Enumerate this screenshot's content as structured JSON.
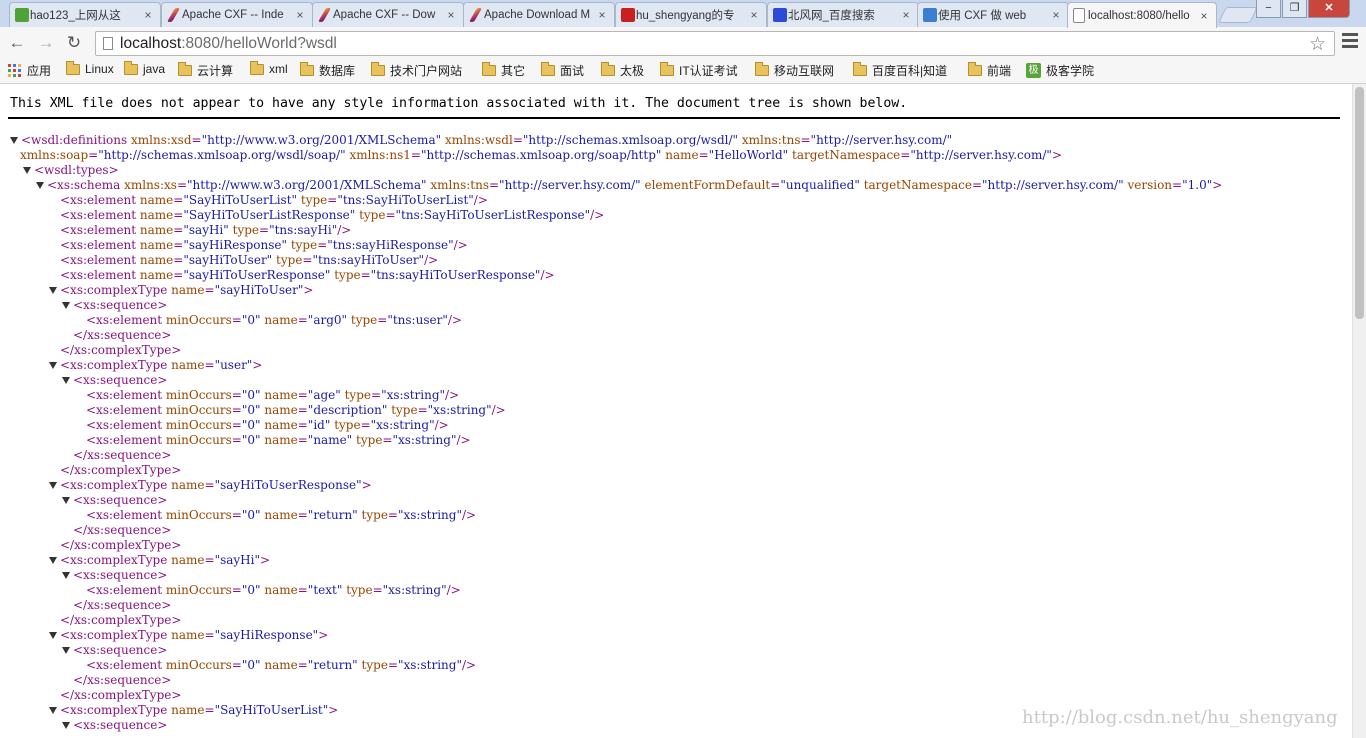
{
  "tabs": [
    {
      "title": "hao123_上网从这",
      "icon": "hao123-icon",
      "color": "#4da338"
    },
    {
      "title": "Apache CXF -- Inde",
      "icon": "apache-feather-icon",
      "color": "#b0305f"
    },
    {
      "title": "Apache CXF -- Dow",
      "icon": "apache-feather-icon",
      "color": "#b0305f"
    },
    {
      "title": "Apache Download M",
      "icon": "apache-feather-icon",
      "color": "#b0305f"
    },
    {
      "title": "hu_shengyang的专",
      "icon": "csdn-icon",
      "color": "#c9201f"
    },
    {
      "title": "北风网_百度搜索",
      "icon": "baidu-paw-icon",
      "color": "#2b4bd8"
    },
    {
      "title": "使用 CXF 做 web",
      "icon": "ibm-globe-icon",
      "color": "#3b7fd1"
    },
    {
      "title": "localhost:8080/hello",
      "icon": "page-icon",
      "color": "#ffffff"
    }
  ],
  "window": {
    "minimize": "−",
    "maximize": "❐",
    "close": "✕"
  },
  "toolbar": {
    "back": "←",
    "forward": "→",
    "reload": "↻"
  },
  "address": {
    "host": "localhost",
    "rest": ":8080/helloWorld?wsdl"
  },
  "bookmarks": {
    "apps": "应用",
    "folders": [
      "Linux",
      "java",
      "云计算",
      "xml",
      "数据库",
      "技术门户网站",
      "其它",
      "面试",
      "太极",
      "IT认证考试",
      "移动互联网",
      "百度百科|知道",
      "前端"
    ],
    "jike": "极客学院",
    "jike_icon_text": "极"
  },
  "xml_notice": "This XML file does not appear to have any style information associated with it. The document tree is shown below.",
  "watermark": "http://blog.csdn.net/hu_shengyang",
  "xml_lines": [
    {
      "indent": 0,
      "tri": true,
      "parts": [
        [
          "t",
          "<wsdl:definitions "
        ],
        [
          "n",
          "xmlns:xsd"
        ],
        [
          "t",
          "="
        ],
        [
          "v",
          "\"http://www.w3.org/2001/XMLSchema\""
        ],
        [
          "t",
          " "
        ],
        [
          "n",
          "xmlns:wsdl"
        ],
        [
          "t",
          "="
        ],
        [
          "v",
          "\"http://schemas.xmlsoap.org/wsdl/\""
        ],
        [
          "t",
          " "
        ],
        [
          "n",
          "xmlns:tns"
        ],
        [
          "t",
          "="
        ],
        [
          "v",
          "\"http://server.hsy.com/\""
        ]
      ]
    },
    {
      "indent": 0,
      "tri": false,
      "wrap": true,
      "parts": [
        [
          "n",
          "xmlns:soap"
        ],
        [
          "t",
          "="
        ],
        [
          "v",
          "\"http://schemas.xmlsoap.org/wsdl/soap/\""
        ],
        [
          "t",
          " "
        ],
        [
          "n",
          "xmlns:ns1"
        ],
        [
          "t",
          "="
        ],
        [
          "v",
          "\"http://schemas.xmlsoap.org/soap/http\""
        ],
        [
          "t",
          " "
        ],
        [
          "n",
          "name"
        ],
        [
          "t",
          "="
        ],
        [
          "v",
          "\"HelloWorld\""
        ],
        [
          "t",
          " "
        ],
        [
          "n",
          "targetNamespace"
        ],
        [
          "t",
          "="
        ],
        [
          "v",
          "\"http://server.hsy.com/\""
        ],
        [
          "t",
          ">"
        ]
      ]
    },
    {
      "indent": 1,
      "tri": true,
      "parts": [
        [
          "t",
          "<wsdl:types>"
        ]
      ]
    },
    {
      "indent": 2,
      "tri": true,
      "parts": [
        [
          "t",
          "<xs:schema "
        ],
        [
          "n",
          "xmlns:xs"
        ],
        [
          "t",
          "="
        ],
        [
          "v",
          "\"http://www.w3.org/2001/XMLSchema\""
        ],
        [
          "t",
          " "
        ],
        [
          "n",
          "xmlns:tns"
        ],
        [
          "t",
          "="
        ],
        [
          "v",
          "\"http://server.hsy.com/\""
        ],
        [
          "t",
          " "
        ],
        [
          "n",
          "elementFormDefault"
        ],
        [
          "t",
          "="
        ],
        [
          "v",
          "\"unqualified\""
        ],
        [
          "t",
          " "
        ],
        [
          "n",
          "targetNamespace"
        ],
        [
          "t",
          "="
        ],
        [
          "v",
          "\"http://server.hsy.com/\""
        ],
        [
          "t",
          " "
        ],
        [
          "n",
          "version"
        ],
        [
          "t",
          "="
        ],
        [
          "v",
          "\"1.0\""
        ],
        [
          "t",
          ">"
        ]
      ]
    },
    {
      "indent": 3,
      "tri": false,
      "parts": [
        [
          "t",
          "<xs:element "
        ],
        [
          "n",
          "name"
        ],
        [
          "t",
          "="
        ],
        [
          "v",
          "\"SayHiToUserList\""
        ],
        [
          "t",
          " "
        ],
        [
          "n",
          "type"
        ],
        [
          "t",
          "="
        ],
        [
          "v",
          "\"tns:SayHiToUserList\""
        ],
        [
          "t",
          "/>"
        ]
      ]
    },
    {
      "indent": 3,
      "tri": false,
      "parts": [
        [
          "t",
          "<xs:element "
        ],
        [
          "n",
          "name"
        ],
        [
          "t",
          "="
        ],
        [
          "v",
          "\"SayHiToUserListResponse\""
        ],
        [
          "t",
          " "
        ],
        [
          "n",
          "type"
        ],
        [
          "t",
          "="
        ],
        [
          "v",
          "\"tns:SayHiToUserListResponse\""
        ],
        [
          "t",
          "/>"
        ]
      ]
    },
    {
      "indent": 3,
      "tri": false,
      "parts": [
        [
          "t",
          "<xs:element "
        ],
        [
          "n",
          "name"
        ],
        [
          "t",
          "="
        ],
        [
          "v",
          "\"sayHi\""
        ],
        [
          "t",
          " "
        ],
        [
          "n",
          "type"
        ],
        [
          "t",
          "="
        ],
        [
          "v",
          "\"tns:sayHi\""
        ],
        [
          "t",
          "/>"
        ]
      ]
    },
    {
      "indent": 3,
      "tri": false,
      "parts": [
        [
          "t",
          "<xs:element "
        ],
        [
          "n",
          "name"
        ],
        [
          "t",
          "="
        ],
        [
          "v",
          "\"sayHiResponse\""
        ],
        [
          "t",
          " "
        ],
        [
          "n",
          "type"
        ],
        [
          "t",
          "="
        ],
        [
          "v",
          "\"tns:sayHiResponse\""
        ],
        [
          "t",
          "/>"
        ]
      ]
    },
    {
      "indent": 3,
      "tri": false,
      "parts": [
        [
          "t",
          "<xs:element "
        ],
        [
          "n",
          "name"
        ],
        [
          "t",
          "="
        ],
        [
          "v",
          "\"sayHiToUser\""
        ],
        [
          "t",
          " "
        ],
        [
          "n",
          "type"
        ],
        [
          "t",
          "="
        ],
        [
          "v",
          "\"tns:sayHiToUser\""
        ],
        [
          "t",
          "/>"
        ]
      ]
    },
    {
      "indent": 3,
      "tri": false,
      "parts": [
        [
          "t",
          "<xs:element "
        ],
        [
          "n",
          "name"
        ],
        [
          "t",
          "="
        ],
        [
          "v",
          "\"sayHiToUserResponse\""
        ],
        [
          "t",
          " "
        ],
        [
          "n",
          "type"
        ],
        [
          "t",
          "="
        ],
        [
          "v",
          "\"tns:sayHiToUserResponse\""
        ],
        [
          "t",
          "/>"
        ]
      ]
    },
    {
      "indent": 3,
      "tri": true,
      "parts": [
        [
          "t",
          "<xs:complexType "
        ],
        [
          "n",
          "name"
        ],
        [
          "t",
          "="
        ],
        [
          "v",
          "\"sayHiToUser\""
        ],
        [
          "t",
          ">"
        ]
      ]
    },
    {
      "indent": 4,
      "tri": true,
      "parts": [
        [
          "t",
          "<xs:sequence>"
        ]
      ]
    },
    {
      "indent": 5,
      "tri": false,
      "parts": [
        [
          "t",
          "<xs:element "
        ],
        [
          "n",
          "minOccurs"
        ],
        [
          "t",
          "="
        ],
        [
          "v",
          "\"0\""
        ],
        [
          "t",
          " "
        ],
        [
          "n",
          "name"
        ],
        [
          "t",
          "="
        ],
        [
          "v",
          "\"arg0\""
        ],
        [
          "t",
          " "
        ],
        [
          "n",
          "type"
        ],
        [
          "t",
          "="
        ],
        [
          "v",
          "\"tns:user\""
        ],
        [
          "t",
          "/>"
        ]
      ]
    },
    {
      "indent": 4,
      "tri": false,
      "parts": [
        [
          "t",
          "</xs:sequence>"
        ]
      ]
    },
    {
      "indent": 3,
      "tri": false,
      "parts": [
        [
          "t",
          "</xs:complexType>"
        ]
      ]
    },
    {
      "indent": 3,
      "tri": true,
      "parts": [
        [
          "t",
          "<xs:complexType "
        ],
        [
          "n",
          "name"
        ],
        [
          "t",
          "="
        ],
        [
          "v",
          "\"user\""
        ],
        [
          "t",
          ">"
        ]
      ]
    },
    {
      "indent": 4,
      "tri": true,
      "parts": [
        [
          "t",
          "<xs:sequence>"
        ]
      ]
    },
    {
      "indent": 5,
      "tri": false,
      "parts": [
        [
          "t",
          "<xs:element "
        ],
        [
          "n",
          "minOccurs"
        ],
        [
          "t",
          "="
        ],
        [
          "v",
          "\"0\""
        ],
        [
          "t",
          " "
        ],
        [
          "n",
          "name"
        ],
        [
          "t",
          "="
        ],
        [
          "v",
          "\"age\""
        ],
        [
          "t",
          " "
        ],
        [
          "n",
          "type"
        ],
        [
          "t",
          "="
        ],
        [
          "v",
          "\"xs:string\""
        ],
        [
          "t",
          "/>"
        ]
      ]
    },
    {
      "indent": 5,
      "tri": false,
      "parts": [
        [
          "t",
          "<xs:element "
        ],
        [
          "n",
          "minOccurs"
        ],
        [
          "t",
          "="
        ],
        [
          "v",
          "\"0\""
        ],
        [
          "t",
          " "
        ],
        [
          "n",
          "name"
        ],
        [
          "t",
          "="
        ],
        [
          "v",
          "\"description\""
        ],
        [
          "t",
          " "
        ],
        [
          "n",
          "type"
        ],
        [
          "t",
          "="
        ],
        [
          "v",
          "\"xs:string\""
        ],
        [
          "t",
          "/>"
        ]
      ]
    },
    {
      "indent": 5,
      "tri": false,
      "parts": [
        [
          "t",
          "<xs:element "
        ],
        [
          "n",
          "minOccurs"
        ],
        [
          "t",
          "="
        ],
        [
          "v",
          "\"0\""
        ],
        [
          "t",
          " "
        ],
        [
          "n",
          "name"
        ],
        [
          "t",
          "="
        ],
        [
          "v",
          "\"id\""
        ],
        [
          "t",
          " "
        ],
        [
          "n",
          "type"
        ],
        [
          "t",
          "="
        ],
        [
          "v",
          "\"xs:string\""
        ],
        [
          "t",
          "/>"
        ]
      ]
    },
    {
      "indent": 5,
      "tri": false,
      "parts": [
        [
          "t",
          "<xs:element "
        ],
        [
          "n",
          "minOccurs"
        ],
        [
          "t",
          "="
        ],
        [
          "v",
          "\"0\""
        ],
        [
          "t",
          " "
        ],
        [
          "n",
          "name"
        ],
        [
          "t",
          "="
        ],
        [
          "v",
          "\"name\""
        ],
        [
          "t",
          " "
        ],
        [
          "n",
          "type"
        ],
        [
          "t",
          "="
        ],
        [
          "v",
          "\"xs:string\""
        ],
        [
          "t",
          "/>"
        ]
      ]
    },
    {
      "indent": 4,
      "tri": false,
      "parts": [
        [
          "t",
          "</xs:sequence>"
        ]
      ]
    },
    {
      "indent": 3,
      "tri": false,
      "parts": [
        [
          "t",
          "</xs:complexType>"
        ]
      ]
    },
    {
      "indent": 3,
      "tri": true,
      "parts": [
        [
          "t",
          "<xs:complexType "
        ],
        [
          "n",
          "name"
        ],
        [
          "t",
          "="
        ],
        [
          "v",
          "\"sayHiToUserResponse\""
        ],
        [
          "t",
          ">"
        ]
      ]
    },
    {
      "indent": 4,
      "tri": true,
      "parts": [
        [
          "t",
          "<xs:sequence>"
        ]
      ]
    },
    {
      "indent": 5,
      "tri": false,
      "parts": [
        [
          "t",
          "<xs:element "
        ],
        [
          "n",
          "minOccurs"
        ],
        [
          "t",
          "="
        ],
        [
          "v",
          "\"0\""
        ],
        [
          "t",
          " "
        ],
        [
          "n",
          "name"
        ],
        [
          "t",
          "="
        ],
        [
          "v",
          "\"return\""
        ],
        [
          "t",
          " "
        ],
        [
          "n",
          "type"
        ],
        [
          "t",
          "="
        ],
        [
          "v",
          "\"xs:string\""
        ],
        [
          "t",
          "/>"
        ]
      ]
    },
    {
      "indent": 4,
      "tri": false,
      "parts": [
        [
          "t",
          "</xs:sequence>"
        ]
      ]
    },
    {
      "indent": 3,
      "tri": false,
      "parts": [
        [
          "t",
          "</xs:complexType>"
        ]
      ]
    },
    {
      "indent": 3,
      "tri": true,
      "parts": [
        [
          "t",
          "<xs:complexType "
        ],
        [
          "n",
          "name"
        ],
        [
          "t",
          "="
        ],
        [
          "v",
          "\"sayHi\""
        ],
        [
          "t",
          ">"
        ]
      ]
    },
    {
      "indent": 4,
      "tri": true,
      "parts": [
        [
          "t",
          "<xs:sequence>"
        ]
      ]
    },
    {
      "indent": 5,
      "tri": false,
      "parts": [
        [
          "t",
          "<xs:element "
        ],
        [
          "n",
          "minOccurs"
        ],
        [
          "t",
          "="
        ],
        [
          "v",
          "\"0\""
        ],
        [
          "t",
          " "
        ],
        [
          "n",
          "name"
        ],
        [
          "t",
          "="
        ],
        [
          "v",
          "\"text\""
        ],
        [
          "t",
          " "
        ],
        [
          "n",
          "type"
        ],
        [
          "t",
          "="
        ],
        [
          "v",
          "\"xs:string\""
        ],
        [
          "t",
          "/>"
        ]
      ]
    },
    {
      "indent": 4,
      "tri": false,
      "parts": [
        [
          "t",
          "</xs:sequence>"
        ]
      ]
    },
    {
      "indent": 3,
      "tri": false,
      "parts": [
        [
          "t",
          "</xs:complexType>"
        ]
      ]
    },
    {
      "indent": 3,
      "tri": true,
      "parts": [
        [
          "t",
          "<xs:complexType "
        ],
        [
          "n",
          "name"
        ],
        [
          "t",
          "="
        ],
        [
          "v",
          "\"sayHiResponse\""
        ],
        [
          "t",
          ">"
        ]
      ]
    },
    {
      "indent": 4,
      "tri": true,
      "parts": [
        [
          "t",
          "<xs:sequence>"
        ]
      ]
    },
    {
      "indent": 5,
      "tri": false,
      "parts": [
        [
          "t",
          "<xs:element "
        ],
        [
          "n",
          "minOccurs"
        ],
        [
          "t",
          "="
        ],
        [
          "v",
          "\"0\""
        ],
        [
          "t",
          " "
        ],
        [
          "n",
          "name"
        ],
        [
          "t",
          "="
        ],
        [
          "v",
          "\"return\""
        ],
        [
          "t",
          " "
        ],
        [
          "n",
          "type"
        ],
        [
          "t",
          "="
        ],
        [
          "v",
          "\"xs:string\""
        ],
        [
          "t",
          "/>"
        ]
      ]
    },
    {
      "indent": 4,
      "tri": false,
      "parts": [
        [
          "t",
          "</xs:sequence>"
        ]
      ]
    },
    {
      "indent": 3,
      "tri": false,
      "parts": [
        [
          "t",
          "</xs:complexType>"
        ]
      ]
    },
    {
      "indent": 3,
      "tri": true,
      "parts": [
        [
          "t",
          "<xs:complexType "
        ],
        [
          "n",
          "name"
        ],
        [
          "t",
          "="
        ],
        [
          "v",
          "\"SayHiToUserList\""
        ],
        [
          "t",
          ">"
        ]
      ]
    },
    {
      "indent": 4,
      "tri": true,
      "parts": [
        [
          "t",
          "<xs:sequence>"
        ]
      ]
    }
  ]
}
